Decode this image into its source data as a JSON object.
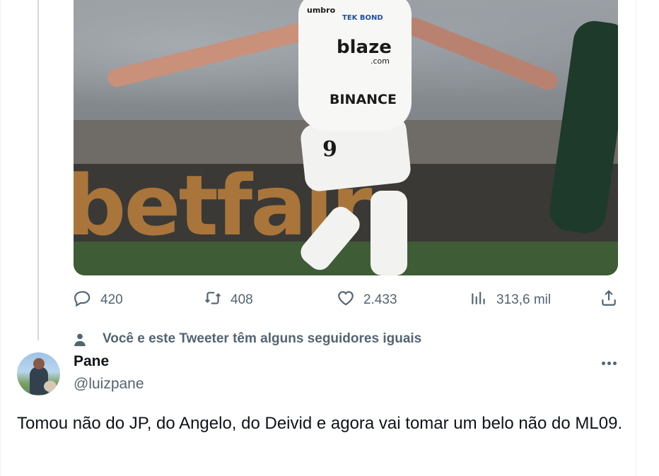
{
  "media": {
    "alt": "Santos player celebrating",
    "board_text": "betfair",
    "shirt_brand": "umbro",
    "shirt_sponsor_1": "TEK BOND",
    "shirt_sponsor_2": "blaze",
    "shirt_sponsor_2_sub": ".com",
    "shirt_sponsor_3": "BINANCE",
    "shirt_number": "9"
  },
  "actions": {
    "replies": "420",
    "retweets": "408",
    "likes": "2.433",
    "views": "313,6 mil"
  },
  "icons": {
    "reply": "reply-icon",
    "retweet": "retweet-icon",
    "like": "heart-icon",
    "views": "views-chart-icon",
    "share": "share-icon",
    "context": "person-icon",
    "more": "more-dots-icon"
  },
  "context": {
    "text": "Você e este Tweeter têm alguns seguidores iguais"
  },
  "tweet": {
    "name": "Pane",
    "handle": "@luizpane",
    "text": "Tomou não do JP, do Angelo, do Deivid e agora vai tomar um belo não do ML09."
  },
  "colors": {
    "secondary_text": "#536471",
    "primary_text": "#0f1419",
    "divider": "#eff3f4",
    "thread_line": "#cfd9de"
  }
}
